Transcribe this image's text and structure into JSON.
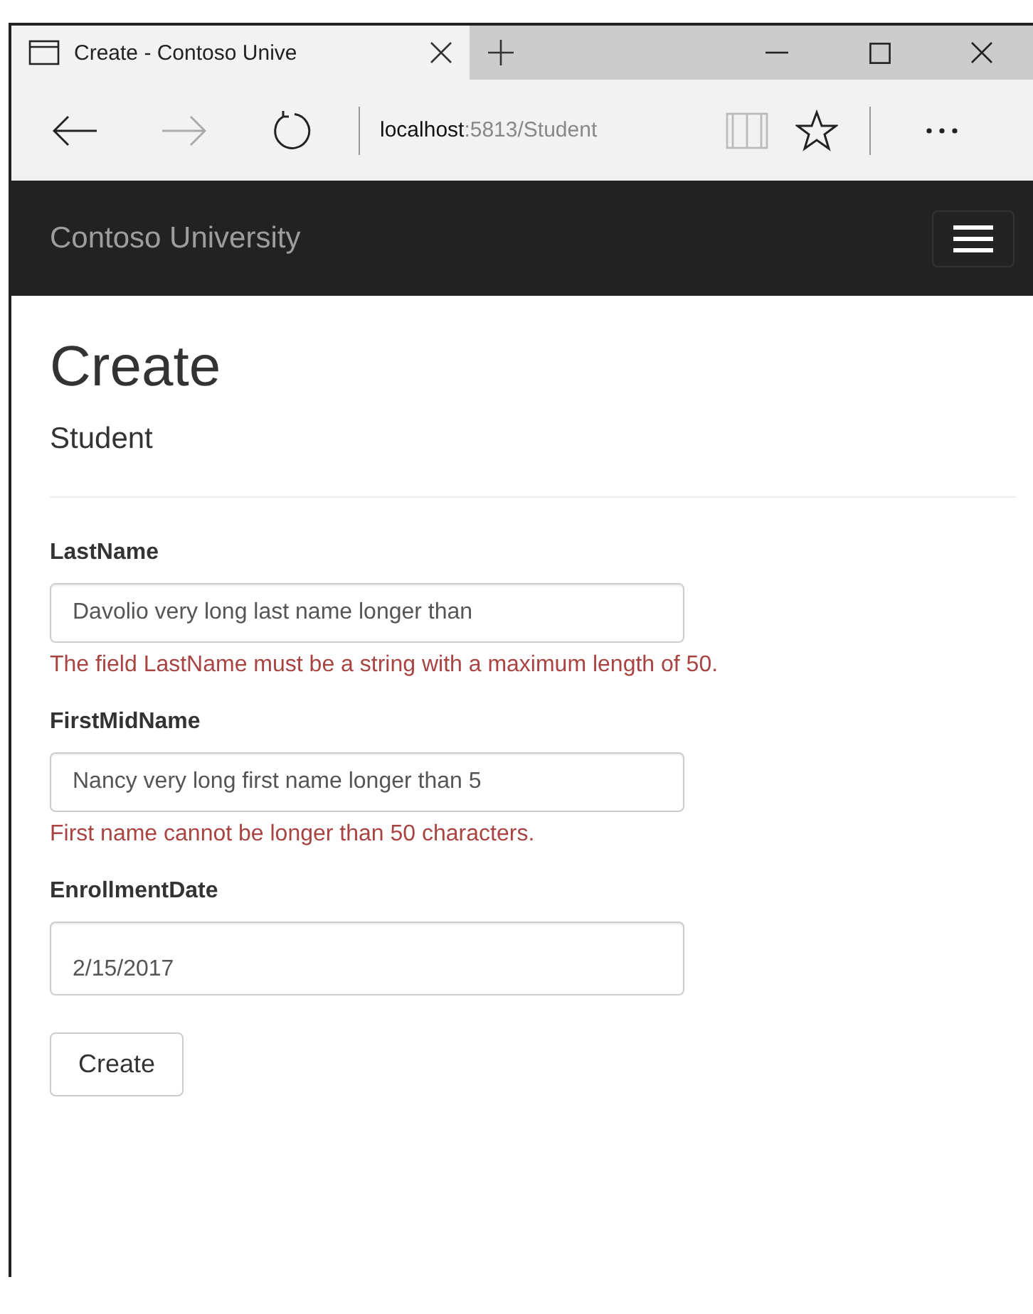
{
  "browser": {
    "tab_title": "Create - Contoso Unive",
    "address": {
      "host": "localhost",
      "path": ":5813/Student"
    }
  },
  "navbar": {
    "brand": "Contoso University"
  },
  "page": {
    "heading": "Create",
    "subheading": "Student"
  },
  "fields": [
    {
      "label": "LastName",
      "value": "Davolio very long last name longer than",
      "kind": "text",
      "error": "The field LastName must be a string with a maximum length of 50."
    },
    {
      "label": "FirstMidName",
      "value": "Nancy very long first name longer than 5",
      "kind": "text",
      "error": "First name cannot be longer than 50 characters."
    },
    {
      "label": "EnrollmentDate",
      "value": "2/15/2017",
      "kind": "date"
    }
  ],
  "submit": "Create"
}
